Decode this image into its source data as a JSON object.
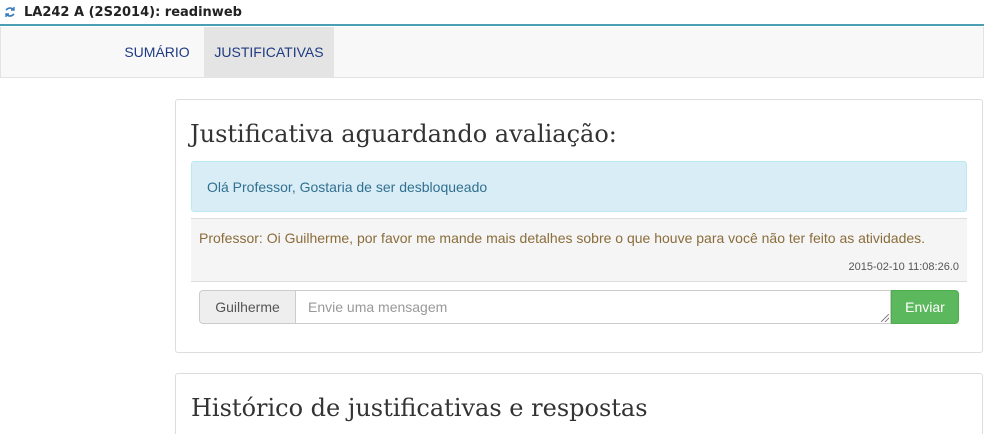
{
  "window": {
    "title": "LA242 A (2S2014): readinweb",
    "icon": "sync-arrows-icon"
  },
  "nav": {
    "tabs": [
      {
        "label": "SUMÁRIO",
        "active": false
      },
      {
        "label": "JUSTIFICATIVAS",
        "active": true
      }
    ]
  },
  "pending": {
    "heading": "Justificativa aguardando avaliação:",
    "student_message": "Olá Professor, Gostaria de ser desbloqueado",
    "reply": {
      "text": "Professor: Oi Guilherme, por favor me mande mais detalhes sobre o que houve para você não ter feito as atividades.",
      "timestamp": "2015-02-10 11:08:26.0"
    },
    "compose": {
      "user_label": "Guilherme",
      "placeholder": "Envie uma mensagem",
      "value": "",
      "send_label": "Enviar"
    }
  },
  "history": {
    "heading": "Histórico de justificativas e respostas"
  },
  "colors": {
    "accent_line": "#4a9fb5",
    "info_bg": "#d9edf7",
    "info_text": "#31708f",
    "reply_text": "#8a6d3b",
    "send_button": "#5cb85c",
    "nav_link": "#1f3b82"
  }
}
